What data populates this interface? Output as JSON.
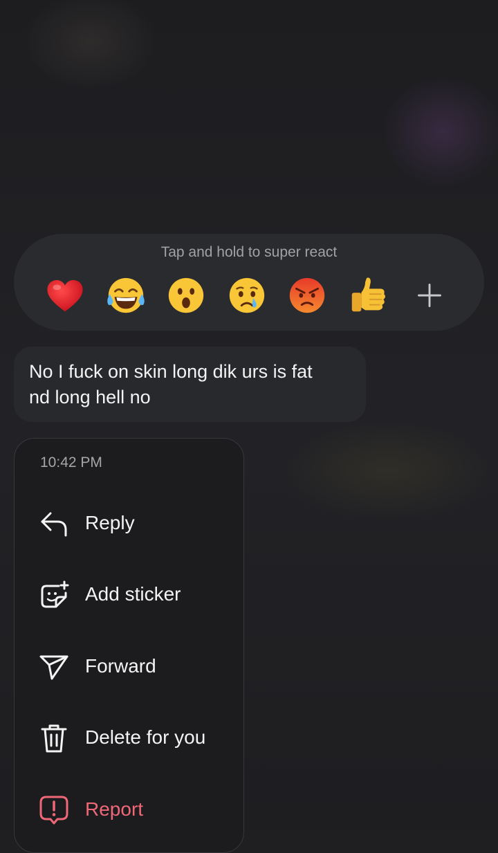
{
  "reactions": {
    "hint": "Tap and hold to super react",
    "items": [
      {
        "icon": "red-heart-emoji"
      },
      {
        "icon": "tears-of-joy-emoji"
      },
      {
        "icon": "surprised-face-emoji"
      },
      {
        "icon": "crying-face-emoji"
      },
      {
        "icon": "angry-face-emoji"
      },
      {
        "icon": "thumbs-up-emoji"
      },
      {
        "icon": "plus-icon"
      }
    ]
  },
  "message": {
    "line1": "No I fuck on skin long dik urs is fat",
    "line2": "nd long hell no"
  },
  "menu": {
    "timestamp": "10:42 PM",
    "items": [
      {
        "label": "Reply",
        "icon": "reply-icon"
      },
      {
        "label": "Add sticker",
        "icon": "sticker-icon"
      },
      {
        "label": "Forward",
        "icon": "forward-icon"
      },
      {
        "label": "Delete for you",
        "icon": "trash-icon"
      },
      {
        "label": "Report",
        "icon": "report-icon",
        "color": "#f06878"
      }
    ]
  },
  "colors": {
    "background": "#1f1f22",
    "bubble": "#28292d",
    "menu": "#1c1c1e",
    "danger": "#f06878"
  }
}
